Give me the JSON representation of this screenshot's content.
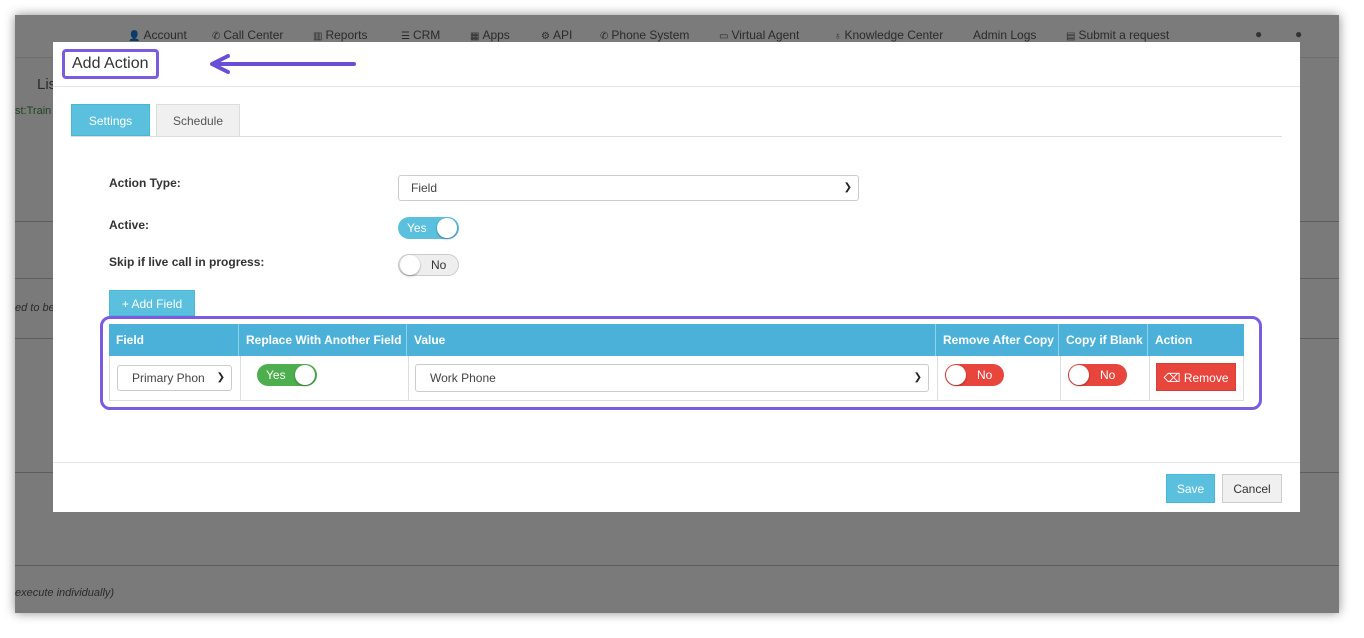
{
  "nav": {
    "items": [
      {
        "icon": "user-icon",
        "glyph": "👤",
        "label": "Account"
      },
      {
        "icon": "phone-icon",
        "glyph": "✆",
        "label": "Call Center"
      },
      {
        "icon": "bar-chart-icon",
        "glyph": "▥",
        "label": "Reports"
      },
      {
        "icon": "list-icon",
        "glyph": "☰",
        "label": "CRM"
      },
      {
        "icon": "grid-icon",
        "glyph": "▦",
        "label": "Apps"
      },
      {
        "icon": "gear-icon",
        "glyph": "⚙",
        "label": "API"
      },
      {
        "icon": "phone-icon",
        "glyph": "✆",
        "label": "Phone System"
      },
      {
        "icon": "monitor-icon",
        "glyph": "▭",
        "label": "Virtual Agent"
      },
      {
        "icon": "lightbulb-icon",
        "glyph": "♁",
        "label": "Knowledge Center"
      },
      {
        "icon": "",
        "glyph": "",
        "label": "Admin Logs"
      },
      {
        "icon": "comments-icon",
        "glyph": "▤",
        "label": "Submit a request"
      }
    ],
    "bell_icon": "bell-icon",
    "user_icon": "user-icon"
  },
  "background": {
    "fragment_1": "Lis",
    "fragment_2": "st:Train",
    "fragment_3": "ed to be",
    "fragment_4": "execute individually)"
  },
  "modal": {
    "title": "Add Action",
    "tabs": [
      {
        "label": "Settings",
        "active": true
      },
      {
        "label": "Schedule",
        "active": false
      }
    ],
    "form": {
      "action_type_label": "Action Type:",
      "action_type_value": "Field",
      "active_label": "Active:",
      "active_value": "Yes",
      "skip_label": "Skip if live call in progress:",
      "skip_value": "No"
    },
    "add_field_label": "+ Add Field",
    "table": {
      "headers": [
        "Field",
        "Replace With Another Field",
        "Value",
        "Remove After Copy",
        "Copy if Blank",
        "Action"
      ],
      "row": {
        "field": "Primary Phon",
        "replace": "Yes",
        "value": "Work Phone",
        "remove_after_copy": "No",
        "copy_if_blank": "No",
        "action": "Remove"
      }
    },
    "save_label": "Save",
    "cancel_label": "Cancel"
  },
  "colors": {
    "accent": "#5bc0de",
    "table_header": "#4bb1d8",
    "danger": "#e8453c",
    "success": "#4cae4c",
    "highlight": "#7b5ce0"
  }
}
